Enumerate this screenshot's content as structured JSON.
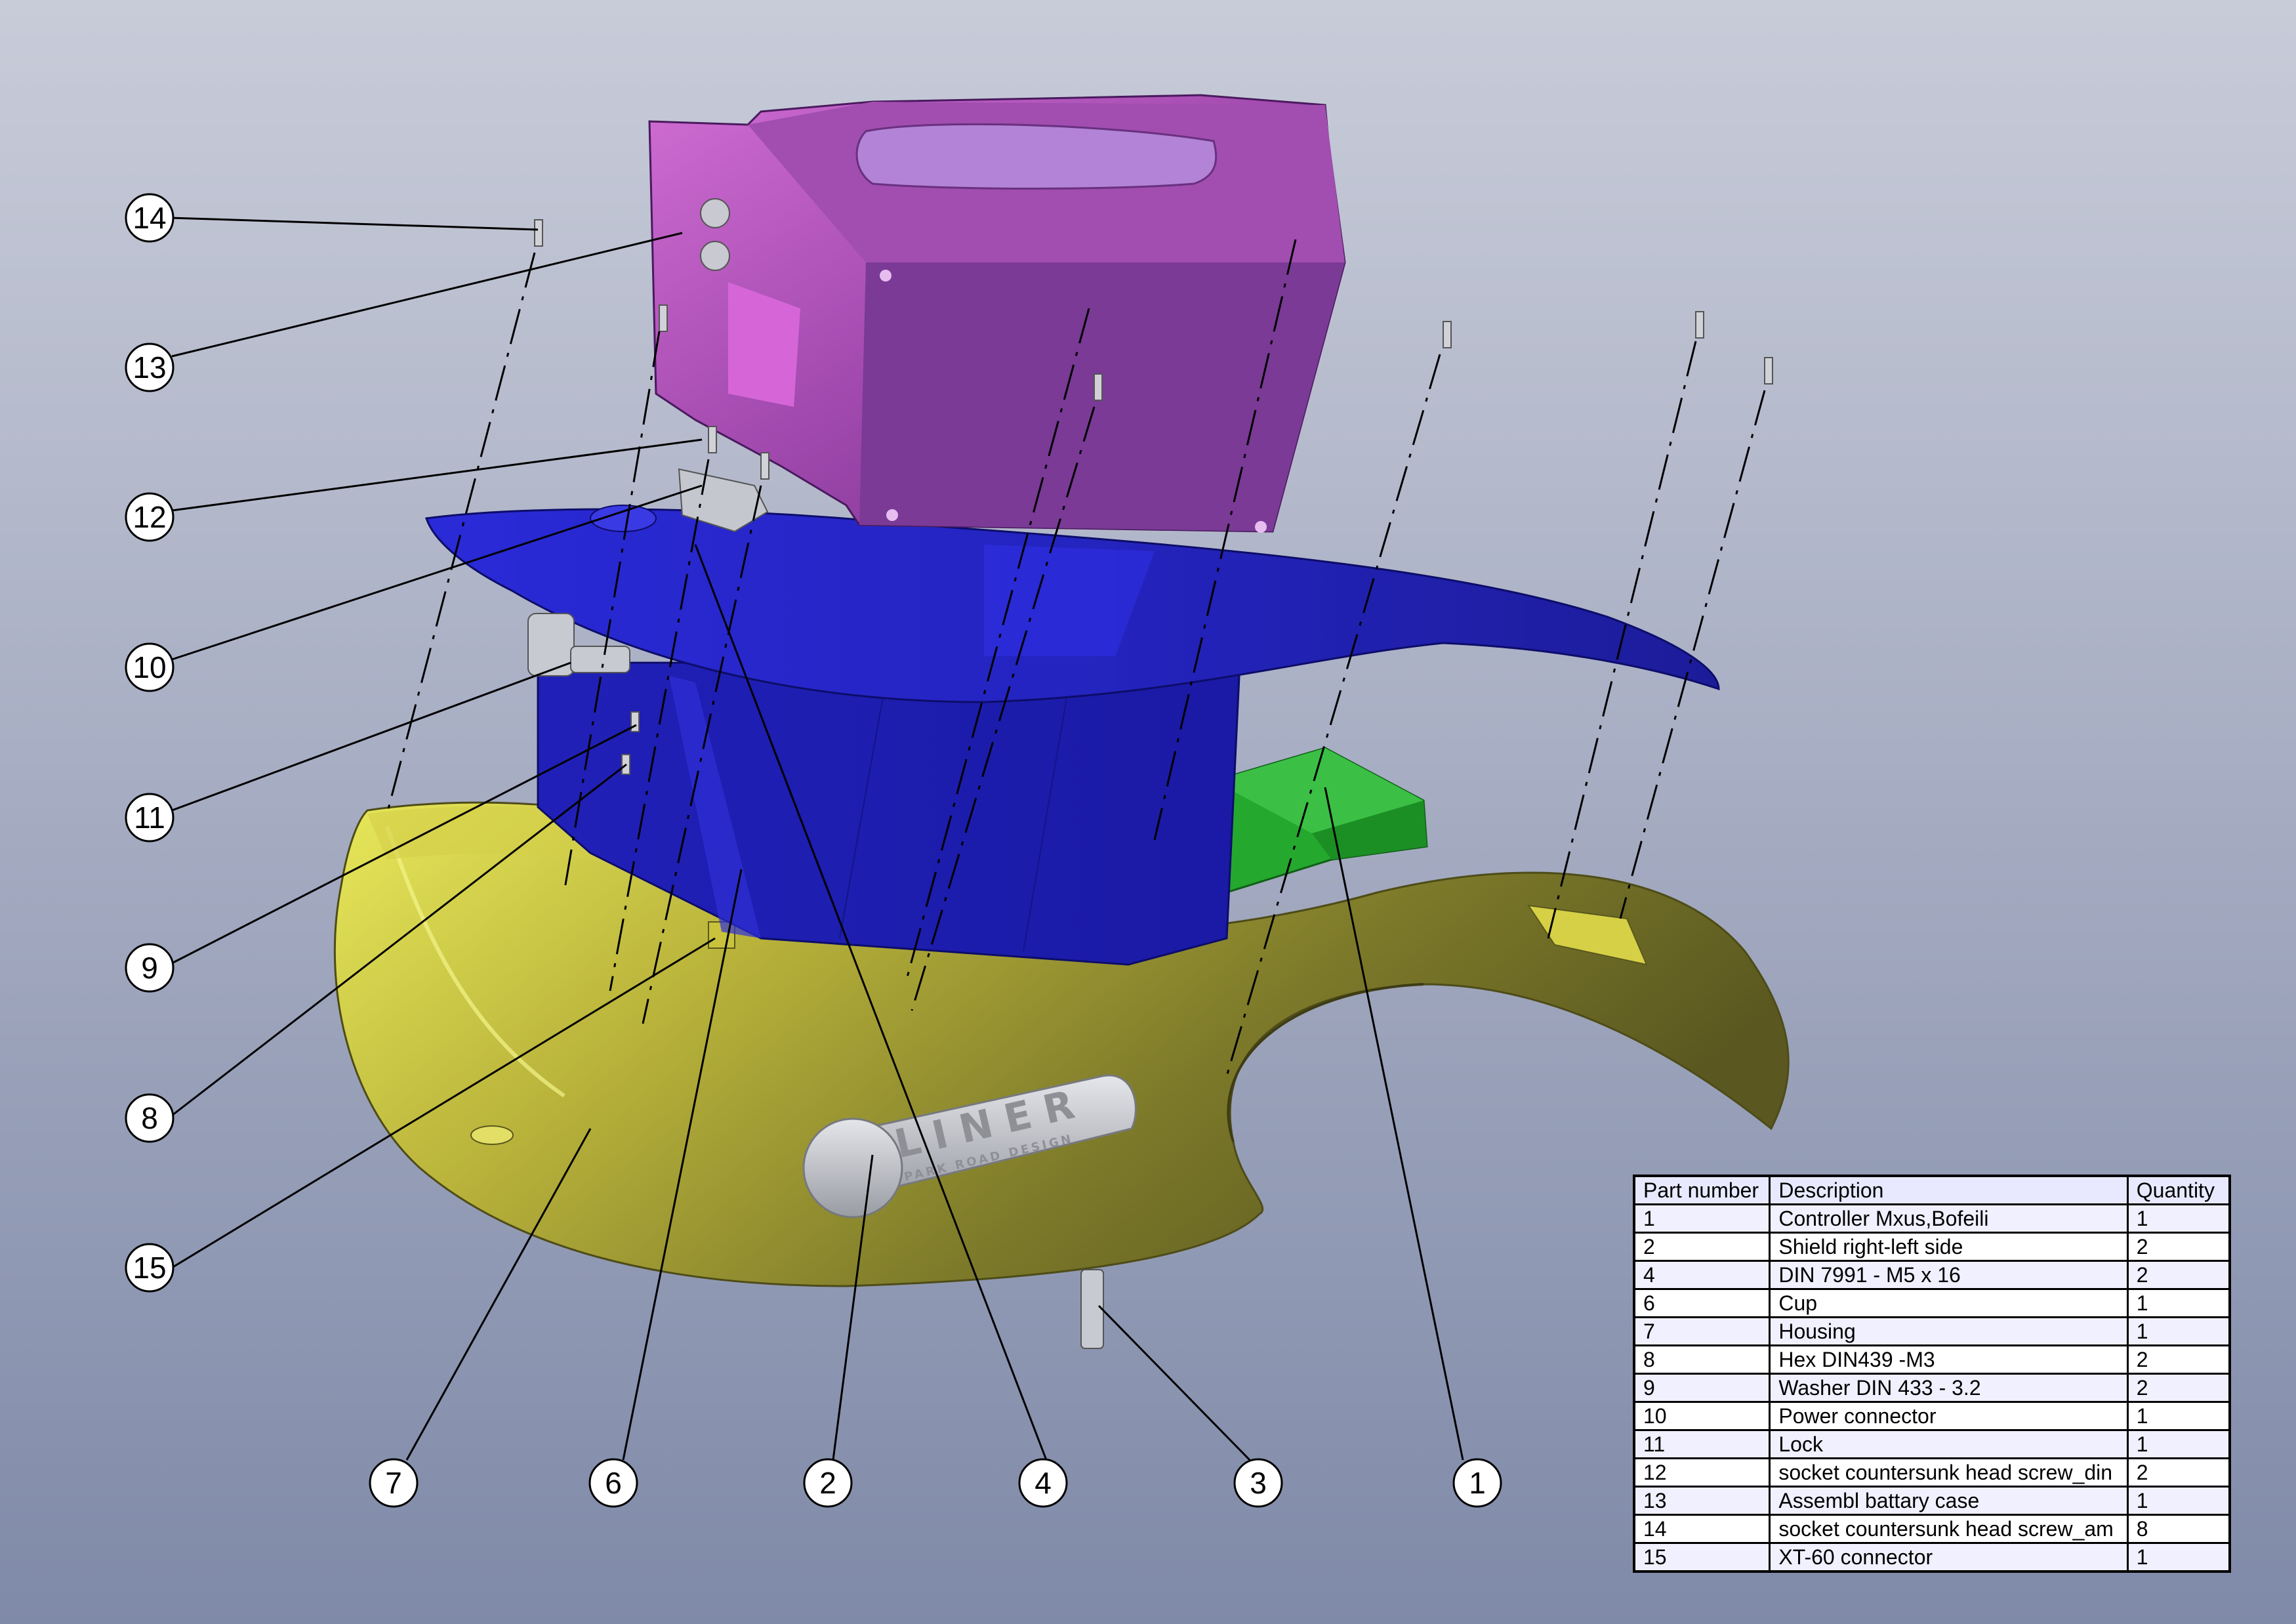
{
  "logo": {
    "brand": "LINER",
    "tagline": "PARK ROAD DESIGN"
  },
  "balloons": {
    "left": [
      "14",
      "13",
      "12",
      "10",
      "11",
      "9",
      "8",
      "15"
    ],
    "bottom": [
      "7",
      "6",
      "2",
      "4",
      "3",
      "1"
    ]
  },
  "bom": {
    "headers": [
      "Part number",
      "Description",
      "Quantity"
    ],
    "rows": [
      [
        "1",
        "Controller Mxus,Bofeili",
        "1"
      ],
      [
        "2",
        "Shield right-left side",
        "2"
      ],
      [
        "4",
        "DIN 7991 - M5 x 16",
        "2"
      ],
      [
        "6",
        "Cup",
        "1"
      ],
      [
        "7",
        "Housing",
        "1"
      ],
      [
        "8",
        "Hex  DIN439 -M3",
        "2"
      ],
      [
        "9",
        "Washer DIN 433 - 3.2",
        "2"
      ],
      [
        "10",
        "Power connector",
        "1"
      ],
      [
        "11",
        "Lock",
        "1"
      ],
      [
        "12",
        "socket countersunk head screw_din",
        "2"
      ],
      [
        "13",
        "Assembl battary case",
        "1"
      ],
      [
        "14",
        "socket countersunk head screw_am",
        "8"
      ],
      [
        "15",
        "XT-60 connector",
        "1"
      ]
    ]
  },
  "colors": {
    "battery_case": "#b04fb4",
    "cup": "#1f1fc8",
    "shield": "#2323c0",
    "controller": "#1fa32a",
    "housing": "#b9b234",
    "logo": "#c4c6cc"
  }
}
